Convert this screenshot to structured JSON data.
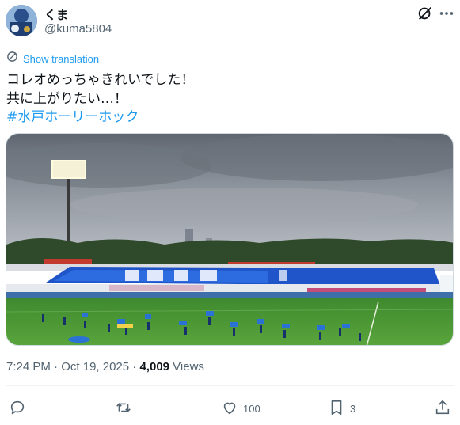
{
  "author": {
    "display_name": "くま",
    "handle": "@kuma5804"
  },
  "translate": {
    "label": "Show translation"
  },
  "tweet": {
    "line1": "コレオめっちゃきれいでした！",
    "line2": "共に上がりたい…！",
    "hashtag": "#水戸ホーリーホック"
  },
  "meta": {
    "time": "7:24 PM",
    "separator1": " · ",
    "date": "Oct 19, 2025",
    "separator2": " · ",
    "views_count": "4,009",
    "views_label": " Views"
  },
  "actions": {
    "reply_count": "",
    "repost_count": "",
    "like_count": "100",
    "bookmark_count": "3"
  },
  "icons": {
    "grok": "grok-icon",
    "translate": "globe-icon",
    "reply": "reply-icon",
    "repost": "repost-icon",
    "like": "heart-icon",
    "bookmark": "bookmark-icon",
    "share": "share-icon"
  },
  "colors": {
    "accent": "#1d9bf0",
    "secondary_text": "#536471",
    "primary_text": "#0f1419"
  }
}
